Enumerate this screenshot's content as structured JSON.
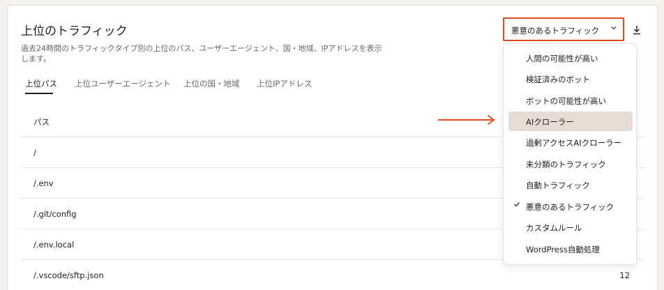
{
  "card": {
    "title": "上位のトラフィック",
    "description": "過去24時間のトラフィックタイプ別の上位のパス、ユーザーエージェント、国・地域、IPアドレスを表示します。"
  },
  "tabs": [
    {
      "label": "上位パス",
      "active": true
    },
    {
      "label": "上位ユーザーエージェント",
      "active": false
    },
    {
      "label": "上位の国・地域",
      "active": false
    },
    {
      "label": "上位IPアドレス",
      "active": false
    }
  ],
  "table": {
    "header_path": "パス",
    "rows": [
      {
        "path": "/",
        "count": ""
      },
      {
        "path": "/.env",
        "count": ""
      },
      {
        "path": "/.git/config",
        "count": ""
      },
      {
        "path": "/.env.local",
        "count": ""
      },
      {
        "path": "/.vscode/sftp.json",
        "count": "12"
      }
    ]
  },
  "filter": {
    "selected": "悪意のあるトラフィック",
    "options": [
      {
        "label": "人間の可能性が高い",
        "checked": false,
        "highlighted": false
      },
      {
        "label": "検証済みのボット",
        "checked": false,
        "highlighted": false
      },
      {
        "label": "ボットの可能性が高い",
        "checked": false,
        "highlighted": false
      },
      {
        "label": "AIクローラー",
        "checked": false,
        "highlighted": true
      },
      {
        "label": "過剰アクセスAIクローラー",
        "checked": false,
        "highlighted": false
      },
      {
        "label": "未分類のトラフィック",
        "checked": false,
        "highlighted": false
      },
      {
        "label": "自動トラフィック",
        "checked": false,
        "highlighted": false
      },
      {
        "label": "悪意のあるトラフィック",
        "checked": true,
        "highlighted": false
      },
      {
        "label": "カスタムルール",
        "checked": false,
        "highlighted": false
      },
      {
        "label": "WordPress自動処理",
        "checked": false,
        "highlighted": false
      }
    ]
  },
  "icons": {
    "check": "check-icon",
    "chevron": "chevron-down-icon",
    "download": "download-icon"
  },
  "colors": {
    "highlight_border": "#e8481c",
    "annotation_arrow": "#e8481c",
    "highlighted_item_bg": "#e7dcd5"
  }
}
